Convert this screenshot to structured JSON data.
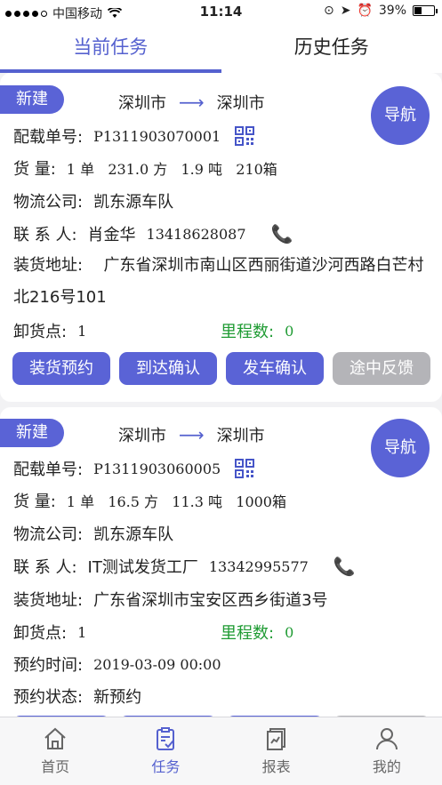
{
  "status": {
    "carrier": "中国移动",
    "time": "11:14",
    "battery": "39%",
    "battery_level": 0.39
  },
  "tabs": [
    {
      "label": "当前任务",
      "active": true
    },
    {
      "label": "历史任务",
      "active": false
    }
  ],
  "cards": [
    {
      "badge": "新建",
      "from": "深圳市",
      "to": "深圳市",
      "nav": "导航",
      "order_label": "配载单号:",
      "order_no": "P1311903070001",
      "goods_label": "货  量:",
      "goods": "1 单   231.0 方   1.9 吨   210箱",
      "company_label": "物流公司:",
      "company": "凯东源车队",
      "contact_label": "联 系 人:",
      "contact_name": "肖金华",
      "contact_phone": "13418628087",
      "address_label": "装货地址:",
      "address": "广东省深圳市南山区西丽街道沙河西路白芒村北216号101",
      "unload_label": "卸货点:",
      "unload": "1",
      "mileage_label": "里程数:",
      "mileage": "0",
      "buttons": [
        "装货预约",
        "到达确认",
        "发车确认",
        "途中反馈"
      ]
    },
    {
      "badge": "新建",
      "from": "深圳市",
      "to": "深圳市",
      "nav": "导航",
      "order_label": "配载单号:",
      "order_no": "P1311903060005",
      "goods_label": "货  量:",
      "goods": "1 单   16.5 方   11.3 吨   1000箱",
      "company_label": "物流公司:",
      "company": "凯东源车队",
      "contact_label": "联 系 人:",
      "contact_name": "IT测试发货工厂",
      "contact_phone": "13342995577",
      "address_label": "装货地址:",
      "address": "广东省深圳市宝安区西乡街道3号",
      "unload_label": "卸货点:",
      "unload": "1",
      "mileage_label": "里程数:",
      "mileage": "0",
      "appt_time_label": "预约时间:",
      "appt_time": "2019-03-09 00:00",
      "appt_status_label": "预约状态:",
      "appt_status": "新预约"
    }
  ],
  "bottom_nav": [
    {
      "label": "首页",
      "icon": "home-icon"
    },
    {
      "label": "任务",
      "icon": "task-icon",
      "active": true
    },
    {
      "label": "报表",
      "icon": "report-icon"
    },
    {
      "label": "我的",
      "icon": "profile-icon"
    }
  ]
}
